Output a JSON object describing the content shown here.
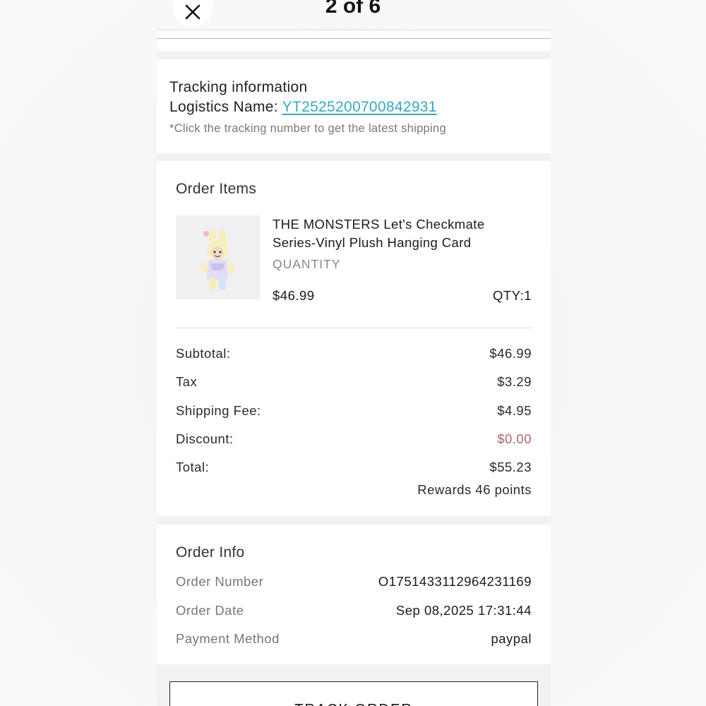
{
  "viewer": {
    "counter": "2 of 6"
  },
  "tracking": {
    "title": "Tracking information",
    "logistics_label": "Logistics Name:",
    "tracking_number": "YT2525200700842931",
    "note": "*Click the tracking number to get the latest shipping"
  },
  "order_items": {
    "title": "Order Items",
    "items": [
      {
        "name": "THE MONSTERS Let's Checkmate Series-Vinyl Plush Hanging Card",
        "quantity_label": "QUANTITY",
        "price": "$46.99",
        "qty": "QTY:1"
      }
    ],
    "summary": {
      "subtotal_label": "Subtotal:",
      "subtotal": "$46.99",
      "tax_label": "Tax",
      "tax": "$3.29",
      "shipping_label": "Shipping Fee:",
      "shipping": "$4.95",
      "discount_label": "Discount:",
      "discount": "$0.00",
      "total_label": "Total:",
      "total": "$55.23",
      "rewards": "Rewards 46 points"
    }
  },
  "order_info": {
    "title": "Order Info",
    "order_number_label": "Order Number",
    "order_number": "O1751433112964231169",
    "order_date_label": "Order Date",
    "order_date": "Sep 08,2025 17:31:44",
    "payment_label": "Payment Method",
    "payment": "paypal"
  },
  "actions": {
    "track_order": "TRACK ORDER"
  },
  "colors": {
    "link": "#3aa7bf",
    "discount": "#b06666"
  },
  "icons": {
    "close": "close-icon"
  }
}
